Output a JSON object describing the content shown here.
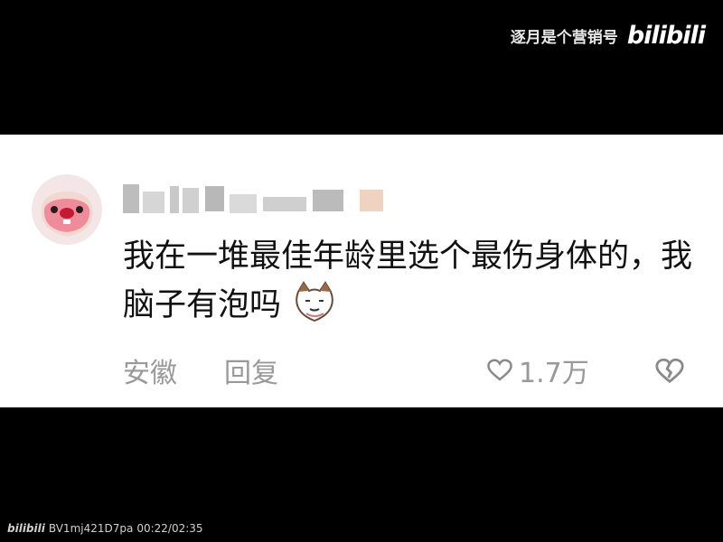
{
  "watermark": {
    "channel_name": "逐月是个营销号",
    "logo_text": "bilibili"
  },
  "comment": {
    "username": "",
    "text": "我在一堆最佳年龄里选个最伤身体的，我脑子有泡吗",
    "location": "安徽",
    "reply_label": "回复",
    "likes": "1.7万",
    "emoji": "cat-face"
  },
  "footer": {
    "logo_text": "bilibili",
    "video_id": "BV1mj421D7pa",
    "time": "00:22/02:35"
  },
  "colors": {
    "background": "#000000",
    "card": "#ffffff",
    "muted_text": "#999999",
    "comment_text": "#111111"
  }
}
